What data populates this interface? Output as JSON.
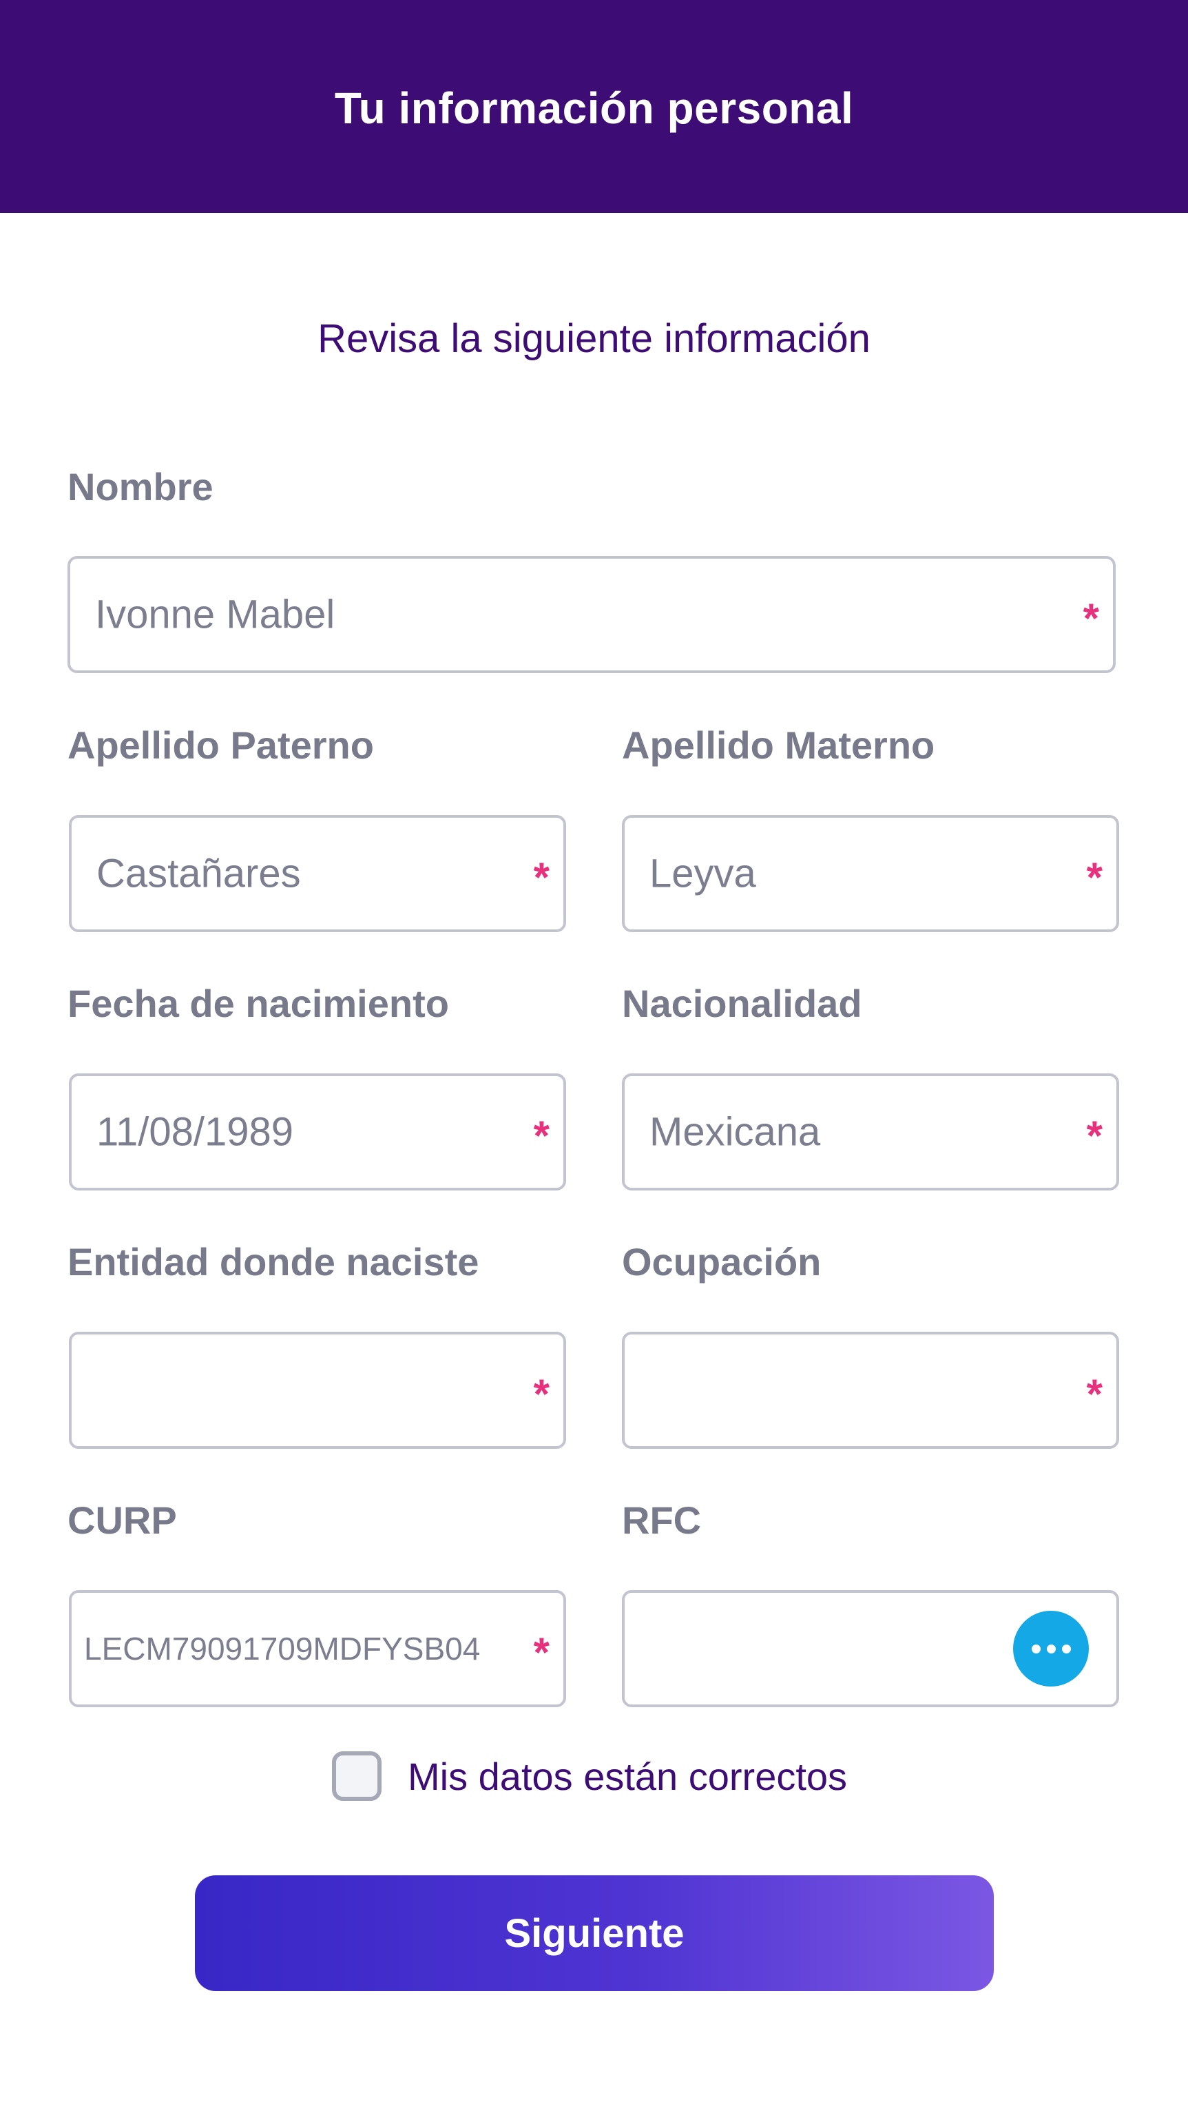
{
  "header": {
    "title": "Tu información personal"
  },
  "subtitle": "Revisa la siguiente información",
  "form": {
    "nombre": {
      "label": "Nombre",
      "value": "Ivonne Mabel",
      "required_mark": "*"
    },
    "apellido_paterno": {
      "label": "Apellido Paterno",
      "value": "Castañares",
      "required_mark": "*"
    },
    "apellido_materno": {
      "label": "Apellido Materno",
      "value": "Leyva",
      "required_mark": "*"
    },
    "fecha_nacimiento": {
      "label": "Fecha de nacimiento",
      "value": "11/08/1989",
      "required_mark": "*"
    },
    "nacionalidad": {
      "label": "Nacionalidad",
      "value": "Mexicana",
      "required_mark": "*"
    },
    "entidad": {
      "label": "Entidad donde naciste",
      "value": "",
      "required_mark": "*"
    },
    "ocupacion": {
      "label": "Ocupación",
      "value": "",
      "required_mark": "*"
    },
    "curp": {
      "label": "CURP",
      "value": "LECM79091709MDFYSB04",
      "required_mark": "*"
    },
    "rfc": {
      "label": "RFC",
      "value": "",
      "action_icon": "more-horizontal-icon"
    }
  },
  "confirm": {
    "label": "Mis datos están correctos",
    "checked": false
  },
  "next_button": {
    "label": "Siguiente"
  },
  "colors": {
    "header_bg": "#3d0c74",
    "accent_text": "#3d0c74",
    "label_text": "#787a8c",
    "required": "#e8317c",
    "more_button": "#14a8e6",
    "button_gradient_start": "#3827c6",
    "button_gradient_end": "#7b57e3"
  }
}
